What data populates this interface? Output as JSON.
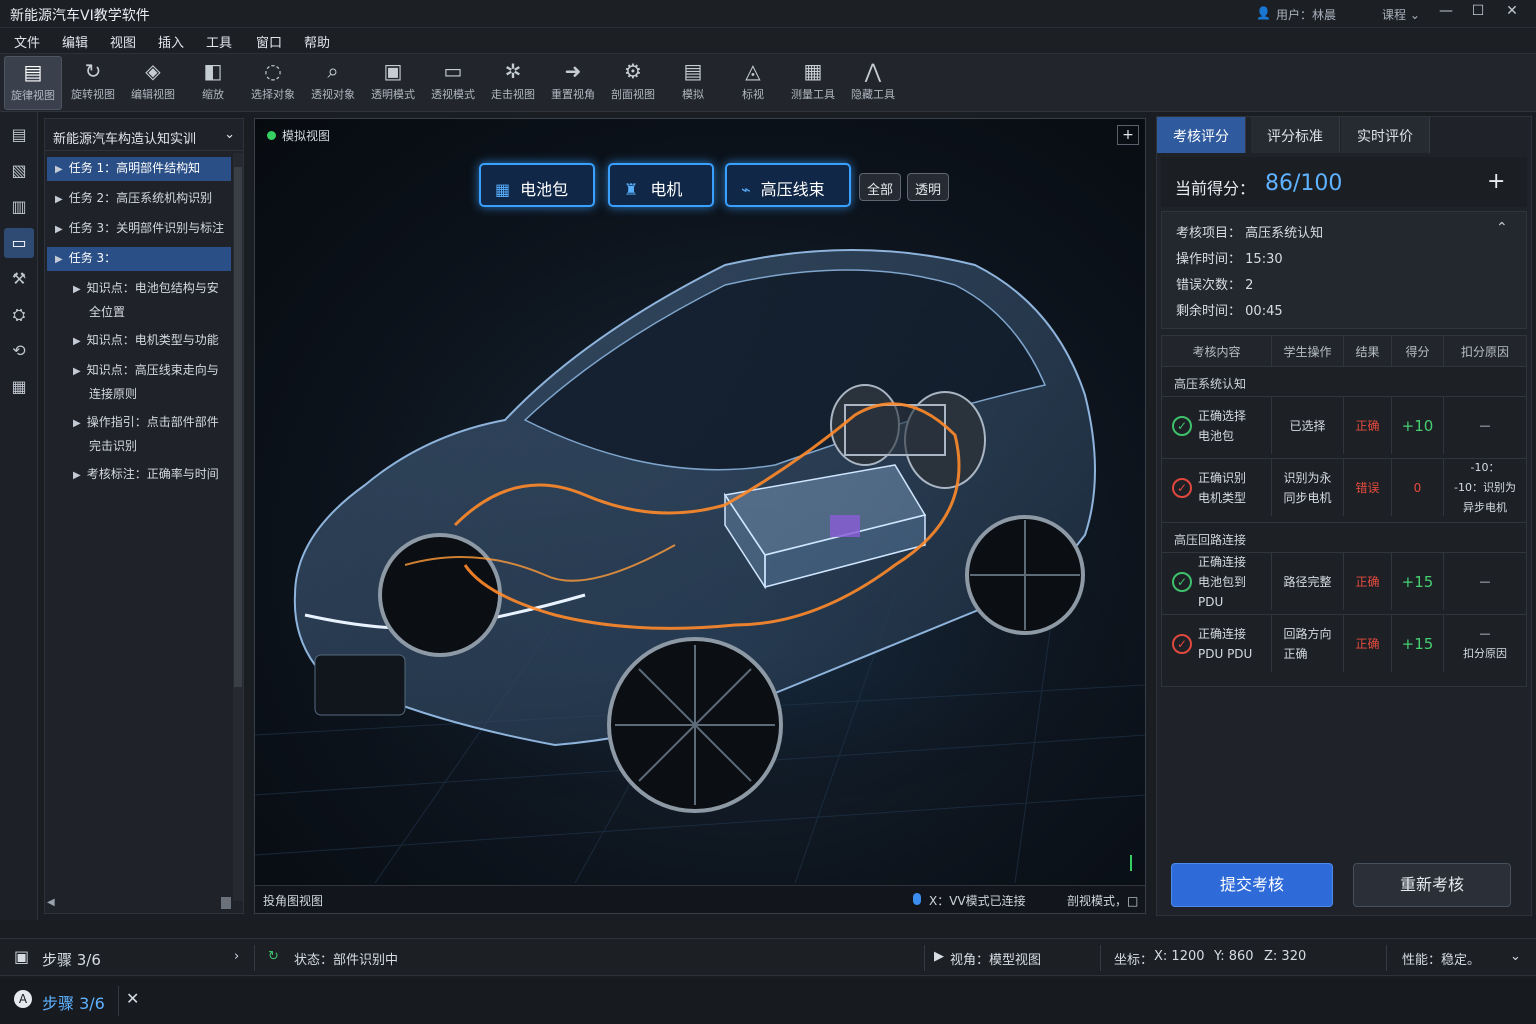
{
  "app": {
    "title": "新能源汽车VI教学软件",
    "user": "用户：林晨",
    "course": "课程"
  },
  "menu": [
    "文件",
    "编辑",
    "视图",
    "插入",
    "工具",
    "窗口",
    "帮助"
  ],
  "toolbar": [
    {
      "icon": "document-icon",
      "glyph": "▤",
      "label": "旋律视图"
    },
    {
      "icon": "rotate-icon",
      "glyph": "↻",
      "label": "旋转视图"
    },
    {
      "icon": "pan-icon",
      "glyph": "◈",
      "label": "编辑视图"
    },
    {
      "icon": "split-icon",
      "glyph": "◧",
      "label": "缩放"
    },
    {
      "icon": "select-icon",
      "glyph": "◌",
      "label": "选择对象"
    },
    {
      "icon": "search-icon",
      "glyph": "⌕",
      "label": "透视对象"
    },
    {
      "icon": "monitor-icon",
      "glyph": "▣",
      "label": "透明模式"
    },
    {
      "icon": "window-icon",
      "glyph": "▭",
      "label": "透视模式"
    },
    {
      "icon": "gear-icon",
      "glyph": "✲",
      "label": "走击视图"
    },
    {
      "icon": "arrow-icon",
      "glyph": "➜",
      "label": "重置视角"
    },
    {
      "icon": "gear-alt-icon",
      "glyph": "⚙",
      "label": "剖面视图"
    },
    {
      "icon": "tape-icon",
      "glyph": "▤",
      "label": "模拟"
    },
    {
      "icon": "layers-icon",
      "glyph": "◬",
      "label": "标视"
    },
    {
      "icon": "chat-icon",
      "glyph": "▦",
      "label": "测量工具"
    },
    {
      "icon": "compass-icon",
      "glyph": "⋀",
      "label": "隐藏工具"
    }
  ],
  "sidebar_icons": [
    "document-icon",
    "cube-icon",
    "page-icon",
    "folder-icon",
    "wrench-icon",
    "engine-icon",
    "loop-icon",
    "grid-icon"
  ],
  "tree": {
    "header": "新能源汽车构造认知实训",
    "items": [
      {
        "label": "任务 1：高明部件结构知",
        "level": 0,
        "selected": true
      },
      {
        "label": "任务 2：高压系统机构识别",
        "level": 0,
        "selected": false
      },
      {
        "label": "任务 3：关明部件识别与标注",
        "level": 0,
        "selected": false
      },
      {
        "label": "任务 3：",
        "level": 0,
        "selected": true
      },
      {
        "label": "知识点：电池包结构与安",
        "label2": "全位置",
        "level": 1
      },
      {
        "label": "知识点：电机类型与功能",
        "level": 1
      },
      {
        "label": "知识点：高压线束走向与",
        "label2": "连接原则",
        "level": 1
      },
      {
        "label": "操作指引：点击部件部件",
        "label2": "完击识别",
        "level": 1
      },
      {
        "label": "考核标注：正确率与时间",
        "level": 1
      }
    ]
  },
  "viewport": {
    "title": "模拟视图",
    "segments": [
      {
        "icon": "grid-icon",
        "label": "电池包"
      },
      {
        "icon": "seat-icon",
        "label": "电机"
      },
      {
        "icon": "cable-icon",
        "label": "高压线束"
      }
    ],
    "all_label": "全部",
    "transparent_label": "透明",
    "bottom_left": "投角图视图",
    "bottom_right": "X：VV模式已连接",
    "bottom_right2": "剖视模式，□"
  },
  "right_panel": {
    "tabs": [
      "考核评分",
      "评分标准",
      "实时评价"
    ],
    "score_label": "当前得分：",
    "score_value": "86/100",
    "eval": [
      {
        "k": "考核项目：",
        "v": "高压系统认知"
      },
      {
        "k": "操作时间：",
        "v": "15:30"
      },
      {
        "k": "错误次数：",
        "v": "2"
      },
      {
        "k": "剩余时间：",
        "v": "00:45"
      }
    ],
    "table_headers": [
      "考核内容",
      "学生操作",
      "结果",
      "得分",
      "扣分原因"
    ],
    "groups": [
      {
        "title": "高压系统认知",
        "rows": [
          {
            "status": "ok",
            "item": "正确选择\n电池包",
            "op": "已选择",
            "result": "正确",
            "score": "+10",
            "reason": "—"
          },
          {
            "status": "bad",
            "item": "正确识别\n电机类型",
            "op": "识别为永\n同步电机",
            "result": "错误",
            "score": "0",
            "reason": "-10：\n-10：识别为\n异步电机"
          }
        ]
      },
      {
        "title": "高压回路连接",
        "rows": [
          {
            "status": "ok",
            "item": "正确连接\n电池包到PDU",
            "op": "路径完整",
            "result": "正确",
            "score": "+15",
            "reason": "—"
          },
          {
            "status": "bad",
            "item": "正确连接\nPDU PDU",
            "op": "回路方向\n正确",
            "result": "正确",
            "score": "+15",
            "reason": "—\n扣分原因"
          }
        ]
      }
    ],
    "submit_label": "提交考核",
    "redo_label": "重新考核"
  },
  "statusbar": {
    "step": "步骤 3/6",
    "status": "状态：部件识别中",
    "view": "视角：模型视图",
    "coords_label": "坐标：",
    "x": "X: 1200",
    "y": "Y: 860",
    "z": "Z: 320",
    "perf": "性能：稳定。"
  },
  "taskbar": {
    "step": "步骤 3/6"
  }
}
